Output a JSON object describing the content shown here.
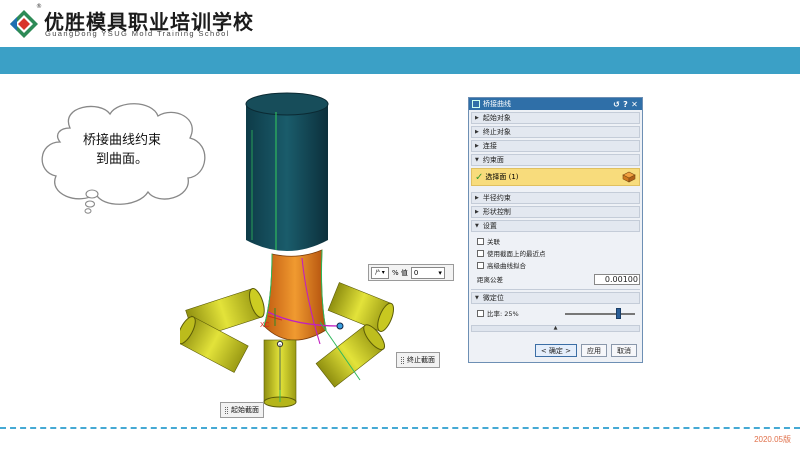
{
  "header": {
    "school_name": "优胜模具职业培训学校",
    "school_sub": "GuangDong YSUG Mold Training School",
    "registered_mark": "®",
    "brand_color": "#3ba0c6"
  },
  "cloud": {
    "line1": "桥接曲线约束",
    "line2": "到曲面。"
  },
  "model": {
    "coord_label": "XC",
    "start_callout": "起始截面",
    "end_callout": "终止截面"
  },
  "mini_toolbar": {
    "percent_label": "% 值",
    "value": "0"
  },
  "dialog": {
    "title": "桥接曲线",
    "title_buttons": [
      "↺",
      "?",
      "✕"
    ],
    "groups_collapsed_top": [
      "起始对象",
      "终止对象",
      "连接"
    ],
    "constraint_group": "约束面",
    "select_face": "选择面 (1)",
    "groups_collapsed_mid": [
      "半径约束",
      "形状控制"
    ],
    "settings_group": "设置",
    "options": [
      "关联",
      "使用截面上的最近点",
      "高级曲线拟合"
    ],
    "tolerance_label": "距离公差",
    "tolerance_value": "0.00100",
    "fine_group": "微定位",
    "ratio_label": "比率: 25%",
    "ratio_value": 0.25,
    "ok": "< 确定 >",
    "apply": "应用",
    "cancel": "取消"
  },
  "footer": {
    "version": "2020.05版"
  }
}
